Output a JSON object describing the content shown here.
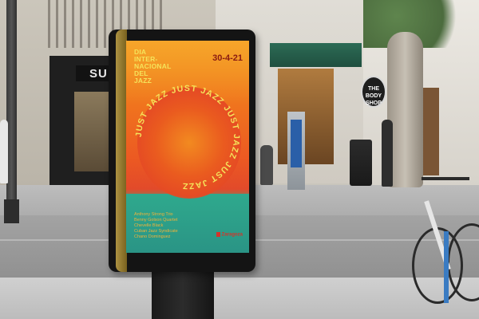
{
  "storefront": {
    "shop_sign": "SU",
    "store_badge": "THE BODY SHOP"
  },
  "poster": {
    "title_lines": [
      "DIA",
      "INTER-",
      "NACIONAL",
      "DEL",
      "JAZZ"
    ],
    "date": "30-4-21",
    "ring_text": "JUST JAZZ JUST JAZZ JUST JAZZ JUST JAZZ ",
    "lineup": [
      "Anthony Strong Trio",
      "Benny Golson Quartet",
      "Chevelle Black",
      "Cuban Jazz Syndicate",
      "Chano Dominguez"
    ],
    "logo": "Zaragoza",
    "colors": {
      "top": "#f08a1e",
      "middle": "#e24a2a",
      "bottom": "#2a9485",
      "title": "#f5e35a",
      "date": "#8a1b12",
      "ring": "#f5e35a"
    }
  }
}
